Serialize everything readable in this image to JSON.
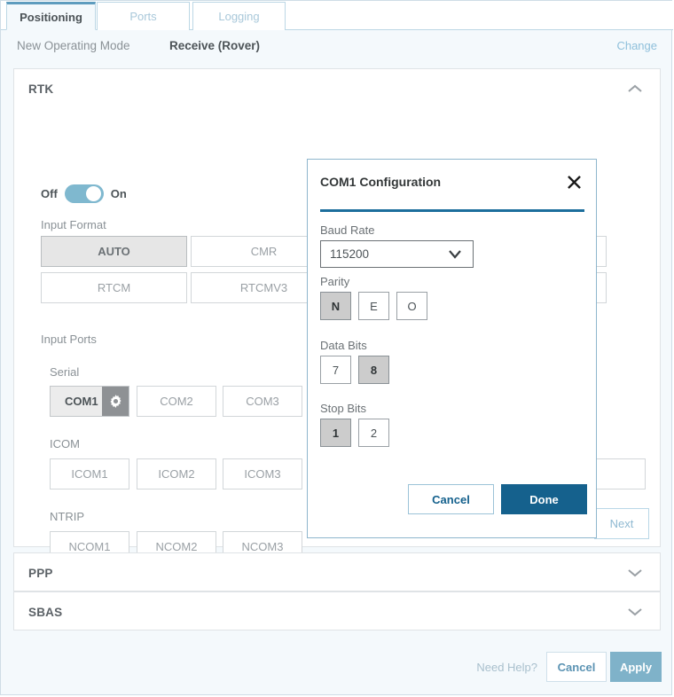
{
  "tabs": [
    {
      "label": "Positioning",
      "active": true
    },
    {
      "label": "Ports",
      "active": false
    },
    {
      "label": "Logging",
      "active": false
    }
  ],
  "mode_bar": {
    "label": "New Operating Mode",
    "value": "Receive (Rover)",
    "change_link": "Change"
  },
  "panels": {
    "rtk": {
      "title": "RTK",
      "chevron": "chevron-up",
      "toggle": {
        "off_label": "Off",
        "on_label": "On",
        "state": "on",
        "track_color": "#7fb8cf"
      },
      "input_format": {
        "label": "Input Format",
        "options": [
          {
            "label": "AUTO",
            "selected": true
          },
          {
            "label": "CMR",
            "selected": false
          },
          {
            "label": "RTCM",
            "selected": false
          },
          {
            "label": "RTCMV3",
            "selected": false
          }
        ]
      },
      "input_ports": {
        "label": "Input Ports",
        "groups": [
          {
            "label": "Serial",
            "ports": [
              {
                "label": "COM1",
                "selected": true,
                "gear": true
              },
              {
                "label": "COM2",
                "selected": false,
                "gear": false
              },
              {
                "label": "COM3",
                "selected": false,
                "gear": false
              }
            ]
          },
          {
            "label": "ICOM",
            "ports": [
              {
                "label": "ICOM1",
                "selected": false,
                "gear": false
              },
              {
                "label": "ICOM2",
                "selected": false,
                "gear": false
              },
              {
                "label": "ICOM3",
                "selected": false,
                "gear": false
              }
            ]
          },
          {
            "label": "NTRIP",
            "ports": [
              {
                "label": "NCOM1",
                "selected": false,
                "gear": false
              },
              {
                "label": "NCOM2",
                "selected": false,
                "gear": false
              },
              {
                "label": "NCOM3",
                "selected": false,
                "gear": false
              }
            ]
          }
        ]
      },
      "next_button": "Next"
    },
    "ppp": {
      "title": "PPP",
      "chevron": "chevron-down"
    },
    "sbas": {
      "title": "SBAS",
      "chevron": "chevron-down"
    }
  },
  "modal": {
    "title": "COM1 Configuration",
    "close_icon": "close-icon",
    "accent_color": "#15618d",
    "baud_rate": {
      "label": "Baud Rate",
      "value": "115200"
    },
    "parity": {
      "label": "Parity",
      "options": [
        {
          "label": "N",
          "selected": true
        },
        {
          "label": "E",
          "selected": false
        },
        {
          "label": "O",
          "selected": false
        }
      ]
    },
    "data_bits": {
      "label": "Data Bits",
      "options": [
        {
          "label": "7",
          "selected": false
        },
        {
          "label": "8",
          "selected": true
        }
      ]
    },
    "stop_bits": {
      "label": "Stop Bits",
      "options": [
        {
          "label": "1",
          "selected": true
        },
        {
          "label": "2",
          "selected": false
        }
      ]
    },
    "cancel_label": "Cancel",
    "done_label": "Done"
  },
  "footer": {
    "need_help": "Need Help?",
    "cancel_label": "Cancel",
    "apply_label": "Apply",
    "apply_color": "#7fb2c9"
  }
}
